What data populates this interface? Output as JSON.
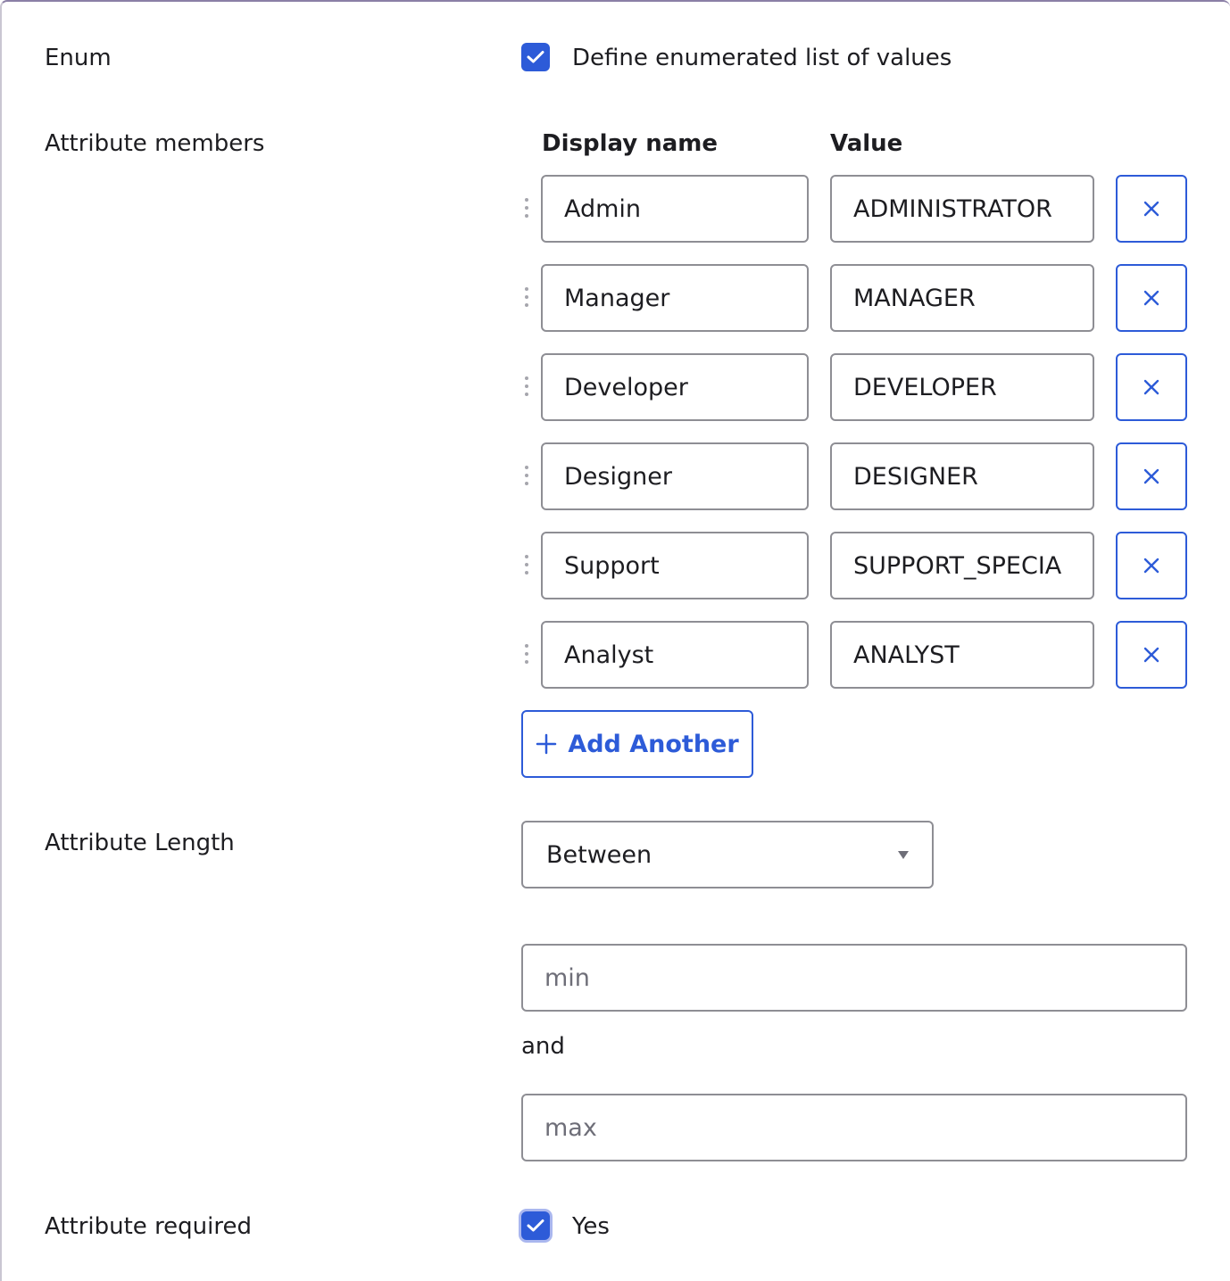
{
  "enum": {
    "label": "Enum",
    "checkbox_checked": true,
    "checkbox_label": "Define enumerated list of values"
  },
  "members": {
    "label": "Attribute members",
    "headers": {
      "display_name": "Display name",
      "value": "Value"
    },
    "rows": [
      {
        "display_name": "Admin",
        "value": "ADMINISTRATOR"
      },
      {
        "display_name": "Manager",
        "value": "MANAGER"
      },
      {
        "display_name": "Developer",
        "value": "DEVELOPER"
      },
      {
        "display_name": "Designer",
        "value": "DESIGNER"
      },
      {
        "display_name": "Support",
        "value": "SUPPORT_SPECIA"
      },
      {
        "display_name": "Analyst",
        "value": "ANALYST"
      }
    ],
    "add_label": "Add Another"
  },
  "length": {
    "label": "Attribute Length",
    "selected": "Between",
    "min_placeholder": "min",
    "and_label": "and",
    "max_placeholder": "max"
  },
  "required": {
    "label": "Attribute required",
    "checkbox_checked": true,
    "checkbox_label": "Yes"
  },
  "colors": {
    "accent": "#2d5bd8",
    "border": "#8e8e94",
    "text": "#1d1d21",
    "placeholder": "#6e6e78"
  }
}
